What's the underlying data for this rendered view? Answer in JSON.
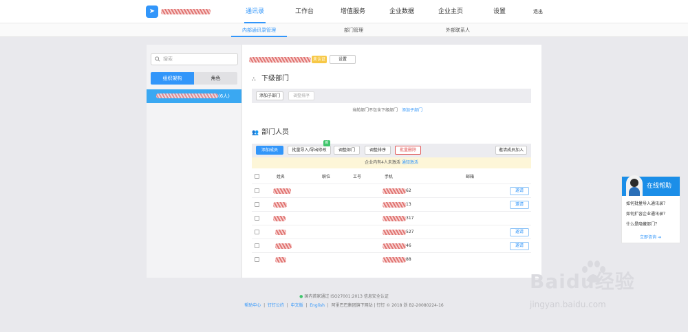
{
  "topnav": {
    "items": [
      "通讯录",
      "工作台",
      "增值服务",
      "企业数据",
      "企业主页",
      "设置"
    ],
    "logout": "退出"
  },
  "subnav": {
    "items": [
      "内部通讯录管理",
      "部门管理",
      "外部联系人"
    ]
  },
  "sidebar": {
    "search_placeholder": "搜索",
    "tab_org": "组织架构",
    "tab_role": "角色",
    "selected_count": "(6人)"
  },
  "main": {
    "tag": "未认证",
    "settings_btn": "设置",
    "sub_title": "下级部门",
    "add_sub_btn": "添加子部门",
    "adjust_order_btn": "调整排序",
    "empty_text": "当前部门不包含下级部门",
    "empty_link": "添加子部门",
    "members_title": "部门人员",
    "toolbar": {
      "add_member": "添加成员",
      "import_export": "批量导入/导出修改",
      "new_badge": "新",
      "adjust_dept": "调整部门",
      "adjust_order": "调整排序",
      "batch_delete": "批量删除",
      "invite_join": "邀请成员加入"
    },
    "notice_text": "企业内有4人未激活",
    "notice_link": "通知激活",
    "columns": [
      "姓名",
      "职位",
      "工号",
      "手机",
      "邮箱"
    ],
    "rows": [
      {
        "phone_suffix": "62",
        "invite": "邀请"
      },
      {
        "phone_suffix": "13",
        "invite": "邀请"
      },
      {
        "phone_suffix": "317",
        "invite": ""
      },
      {
        "phone_suffix": "527",
        "invite": "邀请"
      },
      {
        "phone_suffix": "46",
        "invite": "邀请"
      },
      {
        "phone_suffix": "88",
        "invite": ""
      }
    ]
  },
  "footer": {
    "cert": "国内首家通过 ISO27001:2013 信息安全认证",
    "links": [
      "帮助中心",
      "钉钉公约",
      "中文版",
      "English"
    ],
    "copyright": "阿里巴巴集团旗下网站 | 钉钉 © 2018 浙 B2-20080224-16"
  },
  "help": {
    "title": "在线帮助",
    "questions": [
      "如何批量导入通讯录？",
      "如何扩容企业通讯录？",
      "什么是隐藏部门？"
    ],
    "consult": "立即咨询"
  },
  "watermark": {
    "main": "Baidu经验",
    "sub": "jingyan.baidu.com"
  }
}
